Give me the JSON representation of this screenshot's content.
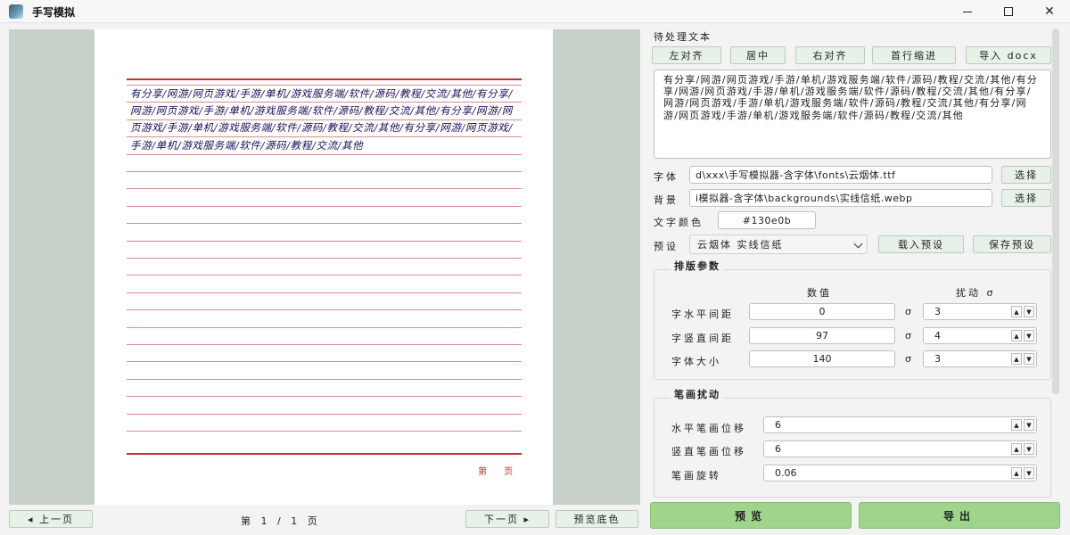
{
  "window": {
    "title": "手写模拟",
    "minimize_icon": "minimize-icon",
    "maximize_icon": "maximize-icon",
    "close_icon": "close-icon"
  },
  "preview": {
    "handwriting_text": "有分享/网游/网页游戏/手游/单机/游戏服务端/软件/源码/教程/交流/其他/有分享/网游/网页游戏/手游/单机/游戏服务端/软件/源码/教程/交流/其他/有分享/网游/网页游戏/手游/单机/游戏服务端/软件/源码/教程/交流/其他/有分享/网游/网页游戏/手游/单机/游戏服务端/软件/源码/教程/交流/其他",
    "page_footer": "第 页",
    "prev_label": "◂ 上一页",
    "next_label": "下一页 ▸",
    "page_indicator": "第 1 / 1 页",
    "bg_color_label": "预览底色"
  },
  "panel": {
    "text_section_label": "待处理文本",
    "align_buttons": [
      "左对齐",
      "居中",
      "右对齐",
      "首行缩进",
      "导入 docx"
    ],
    "input_text": "有分享/网游/网页游戏/手游/单机/游戏服务端/软件/源码/教程/交流/其他/有分享/网游/网页游戏/手游/单机/游戏服务端/软件/源码/教程/交流/其他/有分享/网游/网页游戏/手游/单机/游戏服务端/软件/源码/教程/交流/其他/有分享/网游/网页游戏/手游/单机/游戏服务端/软件/源码/教程/交流/其他",
    "font_label": "字体",
    "font_path": "d\\xxx\\手写模拟器-含字体\\fonts\\云烟体.ttf",
    "bg_label": "背景",
    "bg_path": "i模拟器-含字体\\backgrounds\\实线信纸.webp",
    "choose_label": "选择",
    "color_label": "文字颜色",
    "color_value": "#130e0b",
    "preset_label": "预设",
    "preset_value": "云烟体 实线信纸",
    "load_preset": "载入预设",
    "save_preset": "保存预设",
    "layout_group": {
      "title": "排版参数",
      "col_value": "数值",
      "col_jitter": "扰动 σ",
      "sigma": "σ",
      "rows": [
        {
          "label": "字水平间距",
          "value": "0",
          "jitter": "3"
        },
        {
          "label": "字竖直间距",
          "value": "97",
          "jitter": "4"
        },
        {
          "label": "字体大小",
          "value": "140",
          "jitter": "3"
        }
      ]
    },
    "stroke_group": {
      "title": "笔画扰动",
      "rows": [
        {
          "label": "水平笔画位移",
          "value": "6"
        },
        {
          "label": "竖直笔画位移",
          "value": "6"
        },
        {
          "label": "笔画旋转",
          "value": "0.06"
        }
      ]
    },
    "preview_btn": "预览",
    "export_btn": "导出"
  }
}
